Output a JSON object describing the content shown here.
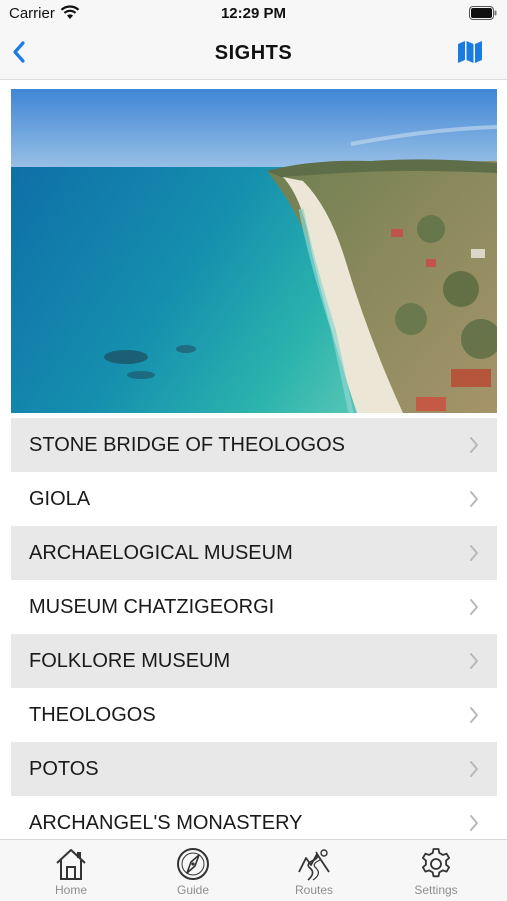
{
  "status_bar": {
    "carrier": "Carrier",
    "time": "12:29 PM"
  },
  "nav": {
    "title": "SIGHTS"
  },
  "sights": [
    {
      "label": "STONE BRIDGE OF THEOLOGOS"
    },
    {
      "label": "GIOLA"
    },
    {
      "label": "ARCHAELOGICAL MUSEUM"
    },
    {
      "label": "MUSEUM CHATZIGEORGI"
    },
    {
      "label": "FOLKLORE MUSEUM"
    },
    {
      "label": "THEOLOGOS"
    },
    {
      "label": "POTOS"
    },
    {
      "label": "ARCHANGEL'S MONASTERY"
    }
  ],
  "tabs": [
    {
      "label": "Home",
      "icon": "home-icon"
    },
    {
      "label": "Guide",
      "icon": "compass-icon"
    },
    {
      "label": "Routes",
      "icon": "routes-icon"
    },
    {
      "label": "Settings",
      "icon": "gear-icon"
    }
  ],
  "colors": {
    "accent": "#1a7ce0",
    "row_alt": "#e8e8e8",
    "tab_inactive": "#8e8e8e"
  }
}
